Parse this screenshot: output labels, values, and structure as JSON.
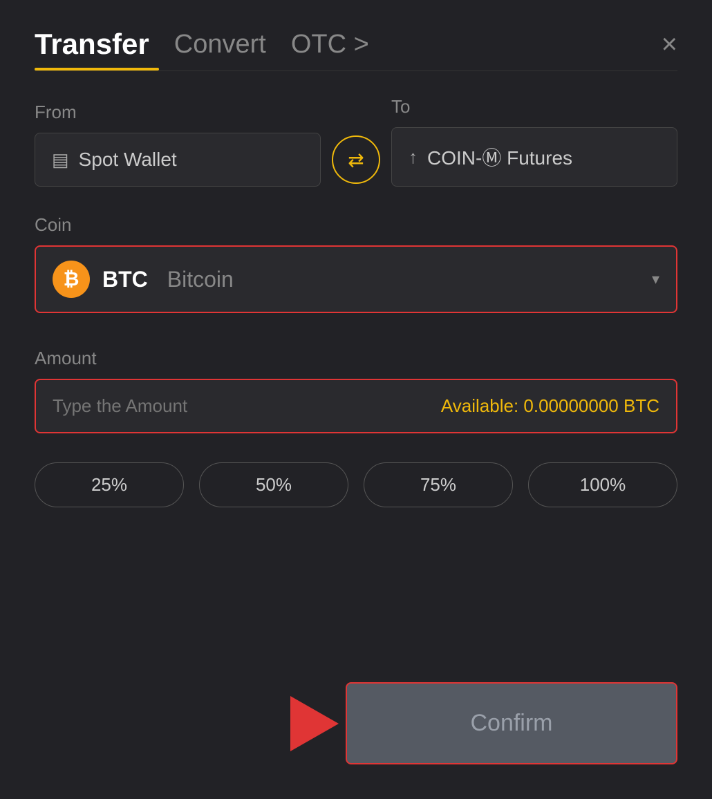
{
  "header": {
    "title": "Transfer",
    "tab_convert": "Convert",
    "tab_otc": "OTC >",
    "close_label": "×"
  },
  "from": {
    "label": "From",
    "wallet_icon": "▤",
    "wallet_text": "Spot Wallet"
  },
  "swap": {
    "icon": "⇄"
  },
  "to": {
    "label": "To",
    "wallet_icon": "↑",
    "wallet_text": "COIN-Ⓜ Futures"
  },
  "coin": {
    "label": "Coin",
    "symbol": "BTC",
    "name": "Bitcoin",
    "chevron": "▾"
  },
  "amount": {
    "label": "Amount",
    "placeholder": "Type the Amount",
    "available_label": "Available:",
    "available_value": "0.00000000 BTC"
  },
  "percentages": [
    "25%",
    "50%",
    "75%",
    "100%"
  ],
  "confirm": {
    "label": "Confirm"
  }
}
